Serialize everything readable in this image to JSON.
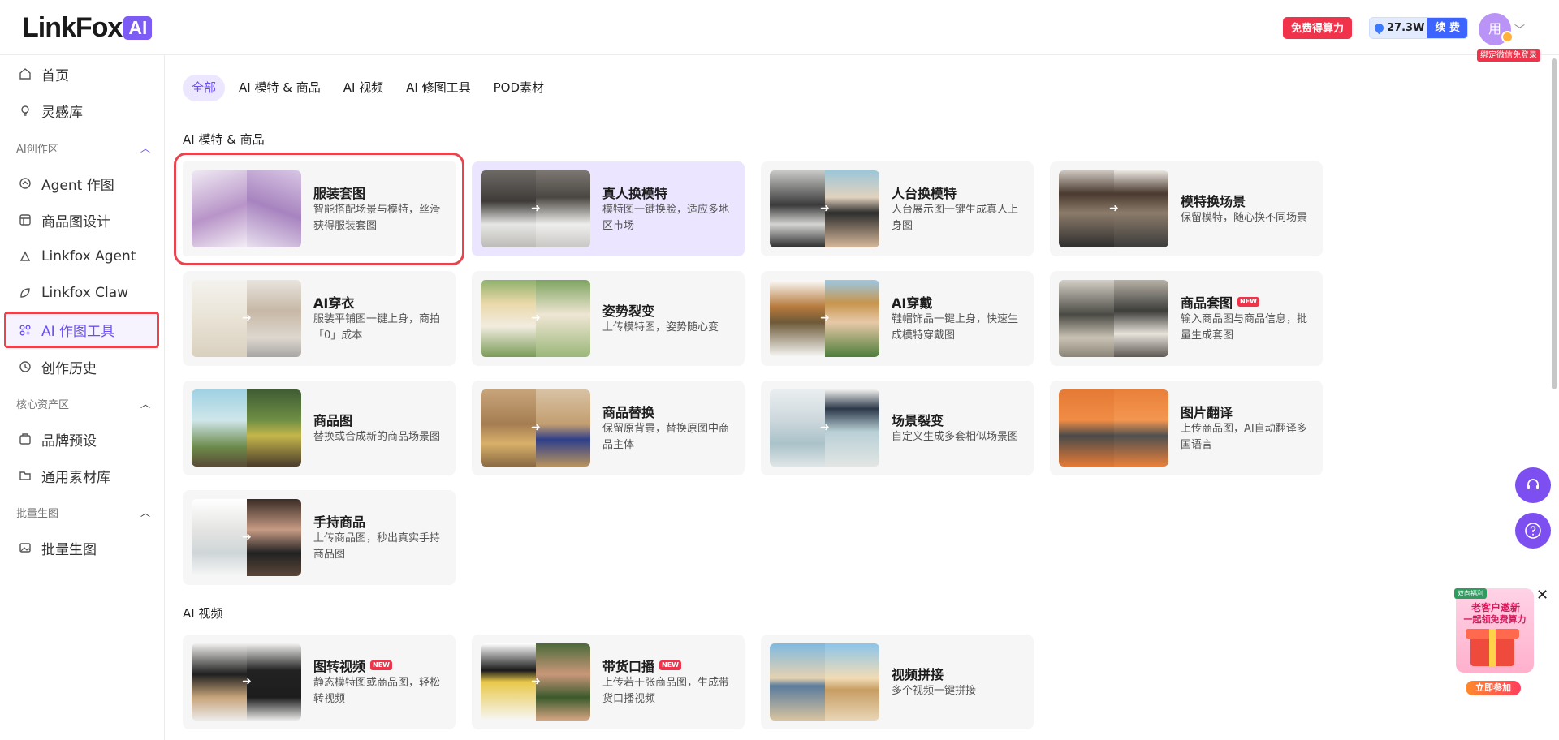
{
  "header": {
    "logo_text": "LinkFox",
    "logo_badge": "AI",
    "free_button": "免费得算力",
    "points": "27.3W",
    "renew": "续 费",
    "avatar_text": "用",
    "bind_tip": "绑定微信免登录"
  },
  "sidebar": {
    "home": "首页",
    "inspiration": "灵感库",
    "section_ai": "AI创作区",
    "agent": "Agent 作图",
    "product_design": "商品图设计",
    "linkfox_agent": "Linkfox Agent",
    "linkfox_claw": "Linkfox Claw",
    "ai_tools": "AI 作图工具",
    "history": "创作历史",
    "section_assets": "核心资产区",
    "brand": "品牌预设",
    "materials": "通用素材库",
    "section_batch": "批量生图",
    "batch": "批量生图"
  },
  "tabs": [
    "全部",
    "AI 模特 & 商品",
    "AI 视频",
    "AI 修图工具",
    "POD素材"
  ],
  "sections": {
    "model_product": "AI 模特 & 商品",
    "video": "AI 视频"
  },
  "cards": [
    {
      "title": "服装套图",
      "desc": "智能搭配场景与模特，丝滑获得服装套图",
      "new": ""
    },
    {
      "title": "真人换模特",
      "desc": "模特图一键换脸，适应多地区市场",
      "new": ""
    },
    {
      "title": "人台换模特",
      "desc": "人台展示图一键生成真人上身图",
      "new": ""
    },
    {
      "title": "模特换场景",
      "desc": "保留模特，随心换不同场景",
      "new": ""
    },
    {
      "title": "AI穿衣",
      "desc": "服装平铺图一键上身，商拍「0」成本",
      "new": ""
    },
    {
      "title": "姿势裂变",
      "desc": "上传模特图，姿势随心变",
      "new": ""
    },
    {
      "title": "AI穿戴",
      "desc": "鞋帽饰品一键上身，快速生成模特穿戴图",
      "new": ""
    },
    {
      "title": "商品套图",
      "desc": "输入商品图与商品信息，批量生成套图",
      "new": "NEW"
    },
    {
      "title": "商品图",
      "desc": "替换或合成新的商品场景图",
      "new": ""
    },
    {
      "title": "商品替换",
      "desc": "保留原背景，替换原图中商品主体",
      "new": ""
    },
    {
      "title": "场景裂变",
      "desc": "自定义生成多套相似场景图",
      "new": ""
    },
    {
      "title": "图片翻译",
      "desc": "上传商品图，AI自动翻译多国语言",
      "new": ""
    },
    {
      "title": "手持商品",
      "desc": "上传商品图，秒出真实手持商品图",
      "new": ""
    },
    {
      "title": "图转视频",
      "desc": "静态模特图或商品图，轻松转视频",
      "new": "NEW"
    },
    {
      "title": "带货口播",
      "desc": "上传若干张商品图，生成带货口播视频",
      "new": "NEW"
    },
    {
      "title": "视频拼接",
      "desc": "多个视频一键拼接",
      "new": ""
    }
  ],
  "promo": {
    "tag": "双向福利",
    "line1": "老客户邀新",
    "line2": "一起领免费算力",
    "cta": "立即参加"
  },
  "colors": {
    "accent": "#6b4ff4",
    "brand": "#7d5cf6",
    "highlight_red": "#e8444e",
    "free_btn": "#f0334a",
    "renew": "#3e64ff"
  }
}
